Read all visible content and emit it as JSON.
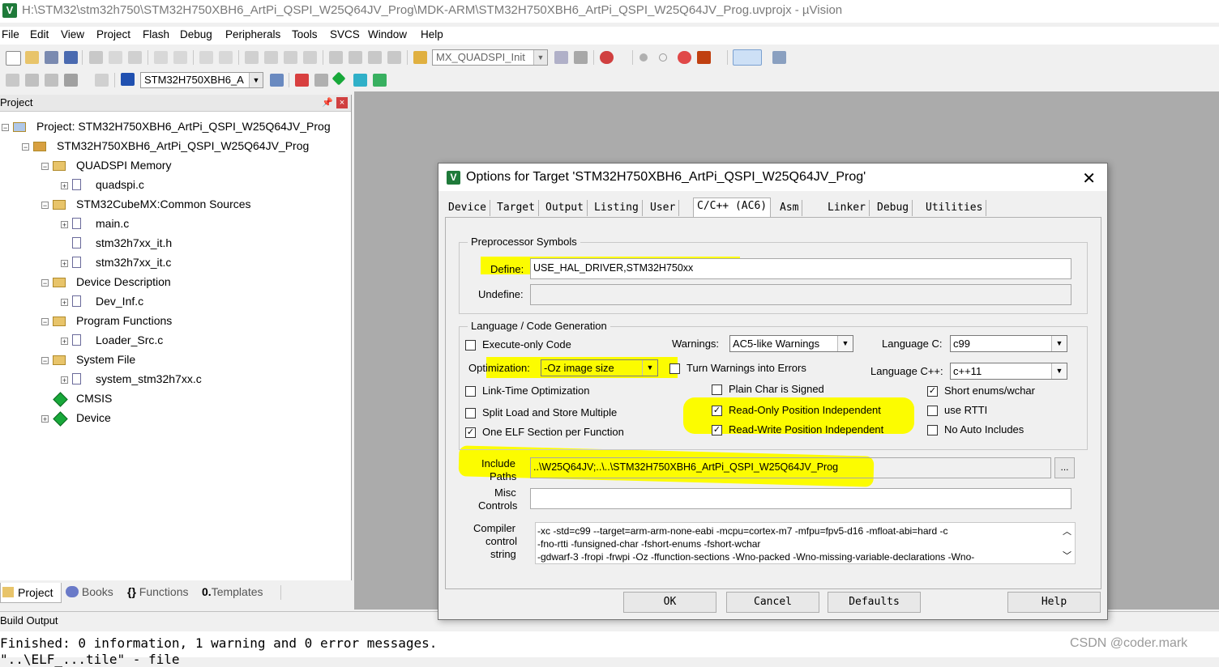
{
  "window": {
    "title": "H:\\STM32\\stm32h750\\STM32H750XBH6_ArtPi_QSPI_W25Q64JV_Prog\\MDK-ARM\\STM32H750XBH6_ArtPi_QSPI_W25Q64JV_Prog.uvprojx - µVision"
  },
  "menu": [
    "File",
    "Edit",
    "View",
    "Project",
    "Flash",
    "Debug",
    "Peripherals",
    "Tools",
    "SVCS",
    "Window",
    "Help"
  ],
  "toolbar": {
    "find_combo": "MX_QUADSPI_Init",
    "target_combo": "STM32H750XBH6_A"
  },
  "project_panel": {
    "title": "Project",
    "tree": [
      {
        "label": "Project: STM32H750XBH6_ArtPi_QSPI_W25Q64JV_Prog",
        "icon": "project-icon"
      },
      {
        "label": "STM32H750XBH6_ArtPi_QSPI_W25Q64JV_Prog",
        "icon": "target-icon"
      },
      {
        "label": "QUADSPI Memory",
        "icon": "folder-icon"
      },
      {
        "label": "quadspi.c",
        "icon": "file-icon"
      },
      {
        "label": "STM32CubeMX:Common Sources",
        "icon": "folder-icon"
      },
      {
        "label": "main.c",
        "icon": "file-icon"
      },
      {
        "label": "stm32h7xx_it.h",
        "icon": "file-icon"
      },
      {
        "label": "stm32h7xx_it.c",
        "icon": "file-icon"
      },
      {
        "label": "Device Description",
        "icon": "folder-icon"
      },
      {
        "label": "Dev_Inf.c",
        "icon": "file-icon"
      },
      {
        "label": "Program Functions",
        "icon": "folder-icon"
      },
      {
        "label": "Loader_Src.c",
        "icon": "file-icon"
      },
      {
        "label": "System File",
        "icon": "folder-icon"
      },
      {
        "label": "system_stm32h7xx.c",
        "icon": "file-icon"
      },
      {
        "label": "CMSIS",
        "icon": "gem-icon"
      },
      {
        "label": "Device",
        "icon": "gem-icon"
      }
    ],
    "bottom_tabs": [
      "Project",
      "Books",
      "Functions",
      "Templates"
    ]
  },
  "build_output": {
    "title": "Build Output",
    "lines": [
      "Finished: 0 information, 1 warning and 0 error messages.",
      "\"..\\ELF_...tile\" - file"
    ]
  },
  "dialog": {
    "title": "Options for Target 'STM32H750XBH6_ArtPi_QSPI_W25Q64JV_Prog'",
    "tabs": [
      "Device",
      "Target",
      "Output",
      "Listing",
      "User",
      "C/C++ (AC6)",
      "Asm",
      "Linker",
      "Debug",
      "Utilities"
    ],
    "active_tab": "C/C++ (AC6)",
    "preprocessor": {
      "group_label": "Preprocessor Symbols",
      "define_label": "Define:",
      "define_value": "USE_HAL_DRIVER,STM32H750xx",
      "undefine_label": "Undefine:",
      "undefine_value": ""
    },
    "codegen": {
      "group_label": "Language / Code Generation",
      "execute_only": "Execute-only Code",
      "optimization_label": "Optimization:",
      "optimization_value": "-Oz image size",
      "lto": "Link-Time Optimization",
      "split_load": "Split Load and Store Multiple",
      "one_elf": "One ELF Section per Function",
      "warnings_label": "Warnings:",
      "warnings_value": "AC5-like Warnings",
      "turn_warnings": "Turn Warnings into Errors",
      "plain_char": "Plain Char is Signed",
      "ro_pi": "Read-Only Position Independent",
      "rw_pi": "Read-Write Position Independent",
      "lang_c_label": "Language C:",
      "lang_c_value": "c99",
      "lang_cpp_label": "Language C++:",
      "lang_cpp_value": "c++11",
      "short_enums": "Short enums/wchar",
      "use_rtti": "use RTTI",
      "no_auto_includes": "No Auto Includes"
    },
    "checks": {
      "execute_only": false,
      "lto": false,
      "split_load": false,
      "one_elf": true,
      "turn_warnings": false,
      "plain_char": false,
      "ro_pi": true,
      "rw_pi": true,
      "short_enums": true,
      "use_rtti": false,
      "no_auto_includes": false
    },
    "include": {
      "label_line1": "Include",
      "label_line2": "Paths",
      "value": "..\\W25Q64JV;..\\..\\STM32H750XBH6_ArtPi_QSPI_W25Q64JV_Prog",
      "browse": "..."
    },
    "misc": {
      "label_line1": "Misc",
      "label_line2": "Controls",
      "value": ""
    },
    "compiler": {
      "label_line1": "Compiler",
      "label_line2": "control",
      "label_line3": "string",
      "lines": [
        "-xc -std=c99 --target=arm-arm-none-eabi -mcpu=cortex-m7 -mfpu=fpv5-d16 -mfloat-abi=hard -c",
        "-fno-rtti -funsigned-char -fshort-enums -fshort-wchar",
        "-gdwarf-3 -fropi -frwpi -Oz -ffunction-sections -Wno-packed -Wno-missing-variable-declarations -Wno-"
      ]
    },
    "buttons": {
      "ok": "OK",
      "cancel": "Cancel",
      "defaults": "Defaults",
      "help": "Help"
    }
  },
  "watermark": "CSDN @coder.mark",
  "colors": {
    "highlight": "#fcfc00",
    "workspace_bg": "#ababab",
    "app_icon": "#1f7a3a"
  }
}
